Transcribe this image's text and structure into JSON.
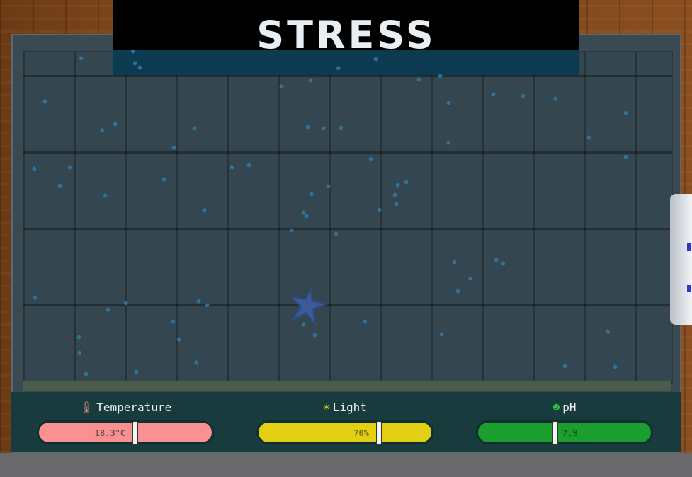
{
  "title": "STRESS",
  "controls": [
    {
      "label": "Temperature",
      "icon": "thermometer-icon",
      "value": "18.3°C",
      "level": 0.54,
      "color": "#f99193",
      "text_color": "#7a4a4a",
      "icon_color": "#f08a8a"
    },
    {
      "label": "Light",
      "icon": "sun-icon",
      "value": "70%",
      "level": 0.68,
      "color": "#e3cf12",
      "text_color": "#7a6a10",
      "icon_color": "#e8d020"
    },
    {
      "label": "pH",
      "icon": "ph-icon",
      "value": "7.9",
      "level": 0.43,
      "color": "#1c9e2e",
      "text_color": "#0f5a18",
      "icon_color": "#30c040"
    }
  ],
  "scene": {
    "creature": "starfish-icon",
    "background": "aquarium-tank"
  }
}
